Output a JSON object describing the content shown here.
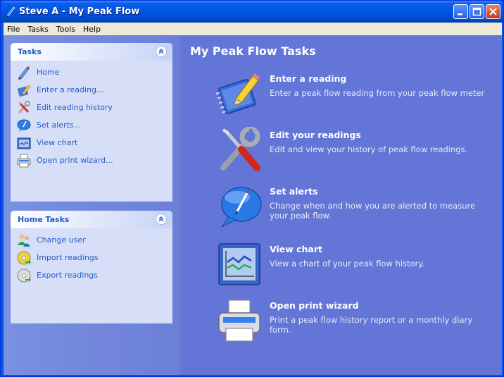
{
  "window": {
    "title": "Steve A - My Peak Flow",
    "controls": {
      "minimize": "minimize",
      "maximize": "maximize",
      "close": "close"
    }
  },
  "menu": [
    "File",
    "Tasks",
    "Tools",
    "Help"
  ],
  "panels": {
    "tasks": {
      "title": "Tasks",
      "items": [
        {
          "label": "Home",
          "icon": "pen-icon"
        },
        {
          "label": "Enter a reading...",
          "icon": "notebook-pencil-icon"
        },
        {
          "label": "Edit reading history",
          "icon": "tools-icon"
        },
        {
          "label": "Set alerts...",
          "icon": "speech-bubble-icon"
        },
        {
          "label": "View chart",
          "icon": "chart-icon"
        },
        {
          "label": "Open print wizard...",
          "icon": "printer-icon"
        }
      ]
    },
    "home_tasks": {
      "title": "Home Tasks",
      "items": [
        {
          "label": "Change user",
          "icon": "users-icon"
        },
        {
          "label": "Import readings",
          "icon": "cd-import-icon"
        },
        {
          "label": "Export readings",
          "icon": "cd-export-icon"
        }
      ]
    }
  },
  "main": {
    "title": "My Peak Flow Tasks",
    "tasks": [
      {
        "title": "Enter a reading",
        "desc": "Enter a peak flow reading from your peak flow meter",
        "icon": "notebook-pencil-icon"
      },
      {
        "title": "Edit your readings",
        "desc": "Edit and view your history of peak flow readings.",
        "icon": "tools-icon"
      },
      {
        "title": "Set alerts",
        "desc": "Change when and how you are alerted to measure your peak flow.",
        "icon": "speech-bubble-icon"
      },
      {
        "title": "View chart",
        "desc": "View a chart of your peak flow history.",
        "icon": "chart-icon"
      },
      {
        "title": "Open print wizard",
        "desc": "Print a peak flow history report or a monthly diary form.",
        "icon": "printer-icon"
      }
    ]
  }
}
